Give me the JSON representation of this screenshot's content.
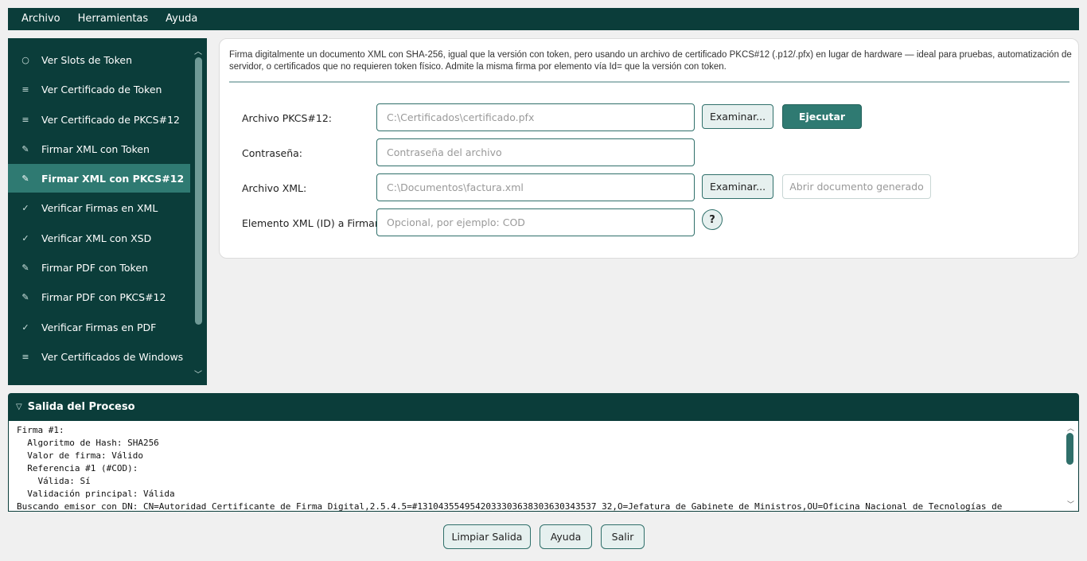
{
  "menu": {
    "archivo": "Archivo",
    "herramientas": "Herramientas",
    "ayuda": "Ayuda"
  },
  "sidebar": {
    "items": [
      {
        "icon": "○",
        "label": "Ver Slots de Token"
      },
      {
        "icon": "≡",
        "label": "Ver Certificado de Token"
      },
      {
        "icon": "≡",
        "label": "Ver Certificado de PKCS#12"
      },
      {
        "icon": "✎",
        "label": "Firmar XML con Token"
      },
      {
        "icon": "✎",
        "label": "Firmar XML con PKCS#12"
      },
      {
        "icon": "✓",
        "label": "Verificar Firmas en XML"
      },
      {
        "icon": "✓",
        "label": "Verificar XML con XSD"
      },
      {
        "icon": "✎",
        "label": "Firmar PDF con Token"
      },
      {
        "icon": "✎",
        "label": "Firmar PDF con PKCS#12"
      },
      {
        "icon": "✓",
        "label": "Verificar Firmas en PDF"
      },
      {
        "icon": "≡",
        "label": "Ver Certificados de Windows"
      }
    ],
    "active_index": 4
  },
  "panel": {
    "description": "Firma digitalmente un documento XML con SHA-256, igual que la versión con token, pero usando un archivo de certificado PKCS#12 (.p12/.pfx) en lugar de hardware — ideal para pruebas, automatización de servidor, o certificados que no requieren token físico. Admite la misma firma por elemento vía Id= que la versión con token.",
    "pkcs_label": "Archivo PKCS#12:",
    "pkcs_placeholder": "C:\\Certificados\\certificado.pfx",
    "browse_label": "Examinar...",
    "execute_label": "Ejecutar",
    "password_label": "Contraseña:",
    "password_placeholder": "Contraseña del archivo",
    "xml_label": "Archivo XML:",
    "xml_placeholder": "C:\\Documentos\\factura.xml",
    "open_generated_label": "Abrir documento generado",
    "element_label": "Elemento XML (ID) a Firmar:",
    "element_placeholder": "Opcional, por ejemplo: COD",
    "help_label": "?"
  },
  "output": {
    "title": "Salida del Proceso",
    "lines": "Firma #1:\n  Algoritmo de Hash: SHA256\n  Valor de firma: Válido\n  Referencia #1 (#COD):\n    Válida: Sí\n  Validación principal: Válida\nBuscando emisor con DN: CN=Autoridad Certificante de Firma Digital,2.5.4.5=#1310435549542033303638303630343537 32,O=Jefatura de Gabinete de Ministros,OU=Oficina Nacional de Tecnologías de"
  },
  "bottom": {
    "clear": "Limpiar Salida",
    "help": "Ayuda",
    "exit": "Salir"
  }
}
